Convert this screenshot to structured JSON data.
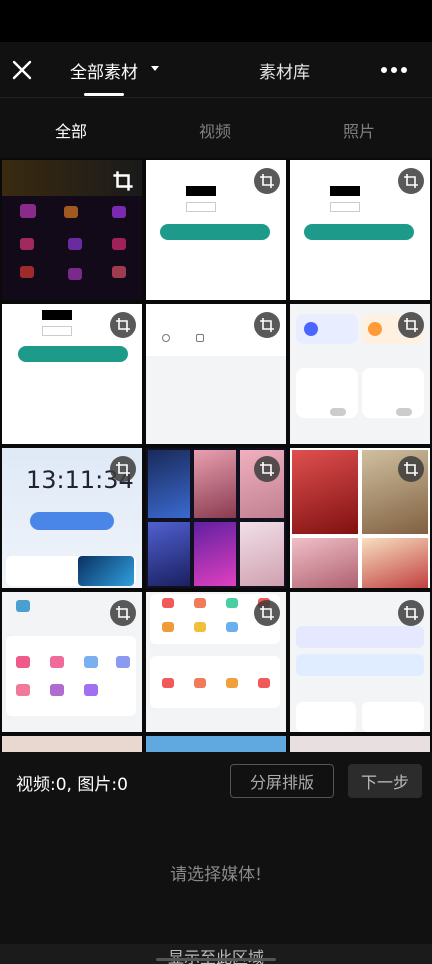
{
  "header": {
    "main_tab": "全部素材",
    "library_tab": "素材库"
  },
  "filters": {
    "all": "全部",
    "video": "视频",
    "photo": "照片"
  },
  "media": {
    "clock_text": "13:11:34"
  },
  "bottom": {
    "count": "视频:0, 图片:0",
    "split": "分屏排版",
    "next": "下一步"
  },
  "empty_hint": "请选择媒体!",
  "footer_text": "显示至此区域",
  "colors": {
    "background": "#111111",
    "accent_teal": "#1e9a8a",
    "muted_text": "#7f7f7f"
  }
}
